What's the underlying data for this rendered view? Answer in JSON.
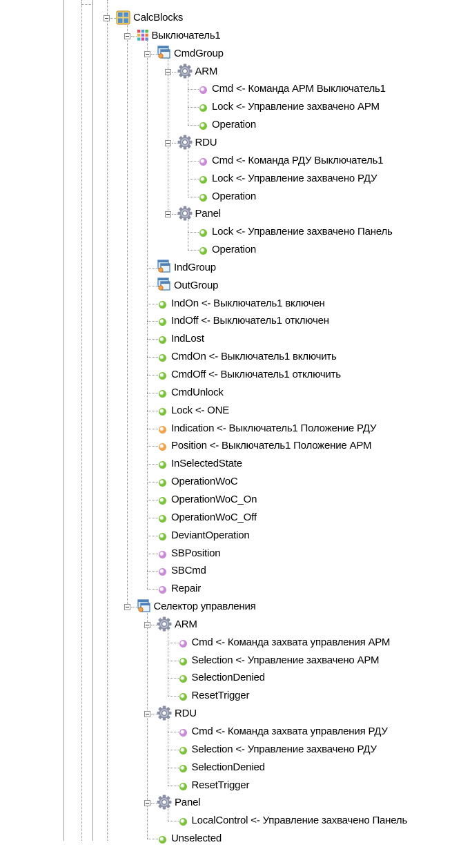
{
  "colors": {
    "green": "#7cc23a",
    "orange": "#f2a24a",
    "purple": "#c98ad6",
    "guide": "#8c8c8c"
  },
  "nodes": [
    {
      "label": "CalcBlocks",
      "depth": 0,
      "kind": "block",
      "expanded": true
    },
    {
      "label": "Выключатель1",
      "depth": 1,
      "kind": "grid",
      "expanded": true
    },
    {
      "label": "CmdGroup",
      "depth": 2,
      "kind": "group",
      "expanded": true
    },
    {
      "label": "ARM",
      "depth": 3,
      "kind": "gear",
      "expanded": true
    },
    {
      "label": "Cmd <- Команда АРМ Выключатель1",
      "depth": 4,
      "kind": "dot",
      "color": "purple"
    },
    {
      "label": "Lock <- Управление захвачено АРМ",
      "depth": 4,
      "kind": "dot",
      "color": "green"
    },
    {
      "label": "Operation",
      "depth": 4,
      "kind": "dot",
      "color": "green"
    },
    {
      "label": "RDU",
      "depth": 3,
      "kind": "gear",
      "expanded": true
    },
    {
      "label": "Cmd <- Команда РДУ Выключатель1",
      "depth": 4,
      "kind": "dot",
      "color": "purple"
    },
    {
      "label": "Lock <- Управление захвачено РДУ",
      "depth": 4,
      "kind": "dot",
      "color": "green"
    },
    {
      "label": "Operation",
      "depth": 4,
      "kind": "dot",
      "color": "green"
    },
    {
      "label": "Panel",
      "depth": 3,
      "kind": "gear",
      "expanded": true
    },
    {
      "label": "Lock <- Управление захвачено Панель",
      "depth": 4,
      "kind": "dot",
      "color": "green"
    },
    {
      "label": "Operation",
      "depth": 4,
      "kind": "dot",
      "color": "green"
    },
    {
      "label": "IndGroup",
      "depth": 2,
      "kind": "group",
      "expanded": false
    },
    {
      "label": "OutGroup",
      "depth": 2,
      "kind": "group",
      "expanded": false
    },
    {
      "label": "IndOn <- Выключатель1 включен",
      "depth": 2,
      "kind": "dot",
      "color": "green"
    },
    {
      "label": "IndOff <- Выключатель1 отключен",
      "depth": 2,
      "kind": "dot",
      "color": "green"
    },
    {
      "label": "IndLost",
      "depth": 2,
      "kind": "dot",
      "color": "green"
    },
    {
      "label": "CmdOn <- Выключатель1 включить",
      "depth": 2,
      "kind": "dot",
      "color": "green"
    },
    {
      "label": "CmdOff <- Выключатель1 отключить",
      "depth": 2,
      "kind": "dot",
      "color": "green"
    },
    {
      "label": "CmdUnlock",
      "depth": 2,
      "kind": "dot",
      "color": "green"
    },
    {
      "label": "Lock <- ONE",
      "depth": 2,
      "kind": "dot",
      "color": "green"
    },
    {
      "label": "Indication <- Выключатель1 Положение РДУ",
      "depth": 2,
      "kind": "dot",
      "color": "orange"
    },
    {
      "label": "Position <- Выключатель1 Положение АРМ",
      "depth": 2,
      "kind": "dot",
      "color": "orange"
    },
    {
      "label": "InSelectedState",
      "depth": 2,
      "kind": "dot",
      "color": "green"
    },
    {
      "label": "OperationWoC",
      "depth": 2,
      "kind": "dot",
      "color": "green"
    },
    {
      "label": "OperationWoC_On",
      "depth": 2,
      "kind": "dot",
      "color": "green"
    },
    {
      "label": "OperationWoC_Off",
      "depth": 2,
      "kind": "dot",
      "color": "green"
    },
    {
      "label": "DeviantOperation",
      "depth": 2,
      "kind": "dot",
      "color": "green"
    },
    {
      "label": "SBPosition",
      "depth": 2,
      "kind": "dot",
      "color": "purple"
    },
    {
      "label": "SBCmd",
      "depth": 2,
      "kind": "dot",
      "color": "purple"
    },
    {
      "label": "Repair",
      "depth": 2,
      "kind": "dot",
      "color": "purple"
    },
    {
      "label": "Селектор управления",
      "depth": 1,
      "kind": "group",
      "expanded": true
    },
    {
      "label": "ARM",
      "depth": 2,
      "kind": "gear",
      "expanded": true
    },
    {
      "label": "Cmd <- Команда захвата управления АРМ",
      "depth": 3,
      "kind": "dot",
      "color": "purple"
    },
    {
      "label": "Selection <- Управление захвачено АРМ",
      "depth": 3,
      "kind": "dot",
      "color": "green"
    },
    {
      "label": "SelectionDenied",
      "depth": 3,
      "kind": "dot",
      "color": "green"
    },
    {
      "label": "ResetTrigger",
      "depth": 3,
      "kind": "dot",
      "color": "green"
    },
    {
      "label": "RDU",
      "depth": 2,
      "kind": "gear",
      "expanded": true
    },
    {
      "label": "Cmd <- Команда захвата управления РДУ",
      "depth": 3,
      "kind": "dot",
      "color": "purple"
    },
    {
      "label": "Selection <- Управление захвачено РДУ",
      "depth": 3,
      "kind": "dot",
      "color": "green"
    },
    {
      "label": "SelectionDenied",
      "depth": 3,
      "kind": "dot",
      "color": "green"
    },
    {
      "label": "ResetTrigger",
      "depth": 3,
      "kind": "dot",
      "color": "green"
    },
    {
      "label": "Panel",
      "depth": 2,
      "kind": "gear",
      "expanded": true
    },
    {
      "label": "LocalControl <- Управление захвачено Панель",
      "depth": 3,
      "kind": "dot",
      "color": "green"
    },
    {
      "label": "Unselected",
      "depth": 2,
      "kind": "dot",
      "color": "green"
    }
  ]
}
